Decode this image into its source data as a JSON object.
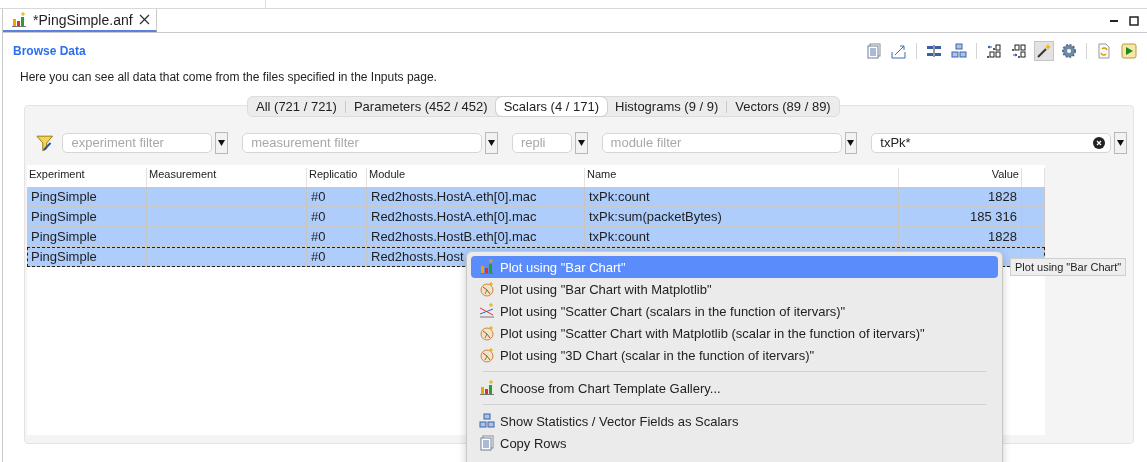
{
  "editor_tab": {
    "title": "*PingSimple.anf",
    "selected": true
  },
  "section_title": "Browse Data",
  "toolbar": [
    {
      "kind": "copy",
      "pressed": false
    },
    {
      "kind": "export",
      "pressed": false
    },
    {
      "kind": "separator"
    },
    {
      "kind": "columns",
      "pressed": false
    },
    {
      "kind": "tree",
      "pressed": false
    },
    {
      "kind": "separator"
    },
    {
      "kind": "fewer-decimals",
      "pressed": false
    },
    {
      "kind": "more-decimals",
      "pressed": false
    },
    {
      "kind": "wand",
      "pressed": true
    },
    {
      "kind": "gear",
      "pressed": false
    },
    {
      "kind": "separator"
    },
    {
      "kind": "refresh",
      "pressed": false
    },
    {
      "kind": "run",
      "pressed": false
    }
  ],
  "description": "Here you can see all data that come from the files specified in the Inputs page.",
  "data_tabs": [
    {
      "label": "All (721 / 721)",
      "selected": false
    },
    {
      "label": "Parameters (452 / 452)",
      "selected": false
    },
    {
      "label": "Scalars (4 / 171)",
      "selected": true
    },
    {
      "label": "Histograms (9 / 9)",
      "selected": false
    },
    {
      "label": "Vectors (89 / 89)",
      "selected": false
    }
  ],
  "filters": [
    {
      "placeholder": "experiment filter"
    },
    {
      "placeholder": "measurement filter"
    },
    {
      "placeholder": "repli"
    },
    {
      "placeholder": "module filter"
    },
    {
      "value": "txPk*"
    }
  ],
  "table": {
    "columns": [
      "Experiment",
      "Measurement",
      "Replicatio",
      "Module",
      "Name",
      "Value"
    ],
    "rows": [
      {
        "cells": [
          "PingSimple",
          "",
          "#0",
          "Red2hosts.HostA.eth[0].mac",
          "txPk:count",
          "1828"
        ],
        "selected": true,
        "focused": false
      },
      {
        "cells": [
          "PingSimple",
          "",
          "#0",
          "Red2hosts.HostA.eth[0].mac",
          "txPk:sum(packetBytes)",
          "185 316"
        ],
        "selected": true,
        "focused": false
      },
      {
        "cells": [
          "PingSimple",
          "",
          "#0",
          "Red2hosts.HostB.eth[0].mac",
          "txPk:count",
          "1828"
        ],
        "selected": true,
        "focused": false
      },
      {
        "cells": [
          "PingSimple",
          null,
          "#0",
          "Red2hosts.Host"
        ],
        "selected": true,
        "focused": true
      }
    ]
  },
  "context_menu": [
    {
      "kind": "bar-chart",
      "label": "Plot using \"Bar Chart\"",
      "selected": true
    },
    {
      "kind": "palette",
      "label": "Plot using \"Bar Chart with Matplotlib\"",
      "selected": false
    },
    {
      "kind": "scatter",
      "label": "Plot using \"Scatter Chart (scalars in the function of itervars)\"",
      "selected": false
    },
    {
      "kind": "palette",
      "label": "Plot using \"Scatter Chart with Matplotlib (scalar in the function of itervars)\"",
      "selected": false
    },
    {
      "kind": "palette",
      "label": "Plot using \"3D Chart (scalar in the function of itervars)\"",
      "selected": false
    },
    {
      "kind": "separator"
    },
    {
      "kind": "bar-chart",
      "label": "Choose from Chart Template Gallery...",
      "selected": false
    },
    {
      "kind": "separator"
    },
    {
      "kind": "tree",
      "label": "Show Statistics / Vector Fields as Scalars",
      "selected": false
    },
    {
      "kind": "copy",
      "label": "Copy Rows",
      "selected": false
    }
  ],
  "tooltip": "Plot using \"Bar Chart\""
}
